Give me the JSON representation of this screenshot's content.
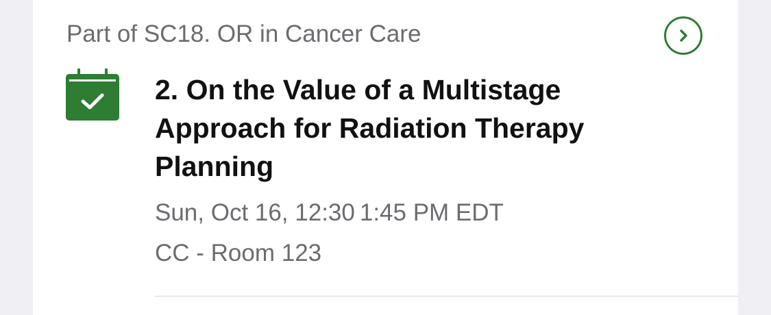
{
  "session": {
    "parent_label": "Part of SC18. OR in Cancer Care",
    "title": "2. On the Value of a Multistage Approach for Radiation Therapy Planning",
    "time": "Sun, Oct 16, 12:30 1:45 PM EDT",
    "room": "CC - Room 123",
    "icons": {
      "calendar": "calendar-check-icon",
      "navigate": "chevron-right-icon"
    }
  },
  "colors": {
    "accent_green": "#2e7d32",
    "secondary_text": "#6b6b70",
    "title_text": "#111111",
    "background": "#efeff4",
    "card": "#ffffff"
  }
}
